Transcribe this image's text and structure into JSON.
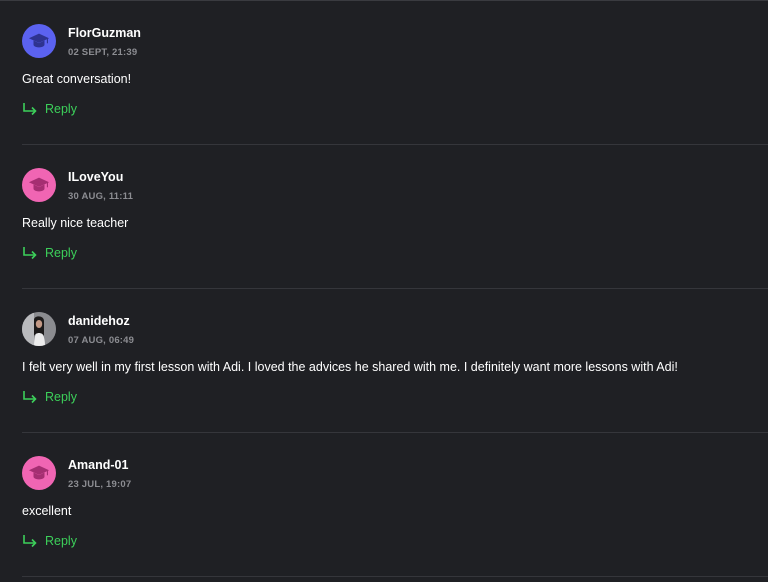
{
  "colors": {
    "background": "#1f2024",
    "reply_accent": "#3ccf5a",
    "avatar_blue": "#5b62f0",
    "avatar_pink": "#f065b3"
  },
  "comments": [
    {
      "author": "FlorGuzman",
      "date": "02 SEPT, 21:39",
      "text": "Great conversation!",
      "reply_label": "Reply",
      "avatar": "graduation-cap-icon",
      "avatar_color": "#5b62f0"
    },
    {
      "author": "ILoveYou",
      "date": "30 AUG, 11:11",
      "text": "Really nice teacher",
      "reply_label": "Reply",
      "avatar": "graduation-cap-icon",
      "avatar_color": "#f065b3"
    },
    {
      "author": "danidehoz",
      "date": "07 AUG, 06:49",
      "text": "I felt very well in my first lesson with Adi. I loved the advices he shared with me. I definitely want more lessons with Adi!",
      "reply_label": "Reply",
      "avatar": "profile-photo",
      "avatar_color": "#6d6e73"
    },
    {
      "author": "Amand-01",
      "date": "23 JUL, 19:07",
      "text": "excellent",
      "reply_label": "Reply",
      "avatar": "graduation-cap-icon",
      "avatar_color": "#f065b3"
    }
  ]
}
